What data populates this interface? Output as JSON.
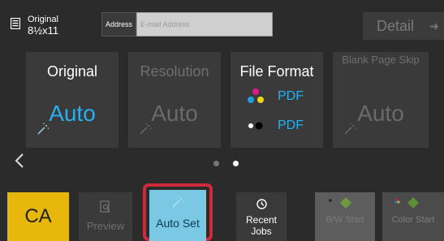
{
  "header": {
    "original_label": "Original",
    "original_size": "8½x11",
    "address_label": "Address",
    "address_placeholder": "E-mail Address",
    "detail_label": "Detail"
  },
  "cards": [
    {
      "title": "Original",
      "value": "Auto",
      "enabled": true
    },
    {
      "title": "Resolution",
      "value": "Auto",
      "enabled": false
    },
    {
      "title": "File Format",
      "formats": [
        "PDF",
        "PDF"
      ],
      "enabled": true
    },
    {
      "title": "Blank Page Skip",
      "value": "Auto",
      "enabled": false
    }
  ],
  "pager": {
    "pages": 2,
    "current": 2
  },
  "footer": {
    "ca_label": "CA",
    "preview_label": "Preview",
    "auto_set_label": "Auto Set",
    "recent_jobs_label": "Recent Jobs",
    "bw_start_label": "B/W Start",
    "color_start_label": "Color Start"
  },
  "colors": {
    "accent": "#28b0ee",
    "ca": "#e8b70b",
    "highlight": "#cf2a3c",
    "auto_set": "#7bc8e4"
  },
  "icons": [
    "original-doc-icon",
    "arrow-right-icon",
    "magic-wand-icon",
    "color-dots-icon",
    "mono-dots-icon",
    "chevron-left-icon",
    "preview-icon",
    "auto-set-icon",
    "recent-jobs-icon",
    "start-diamond-icon"
  ]
}
